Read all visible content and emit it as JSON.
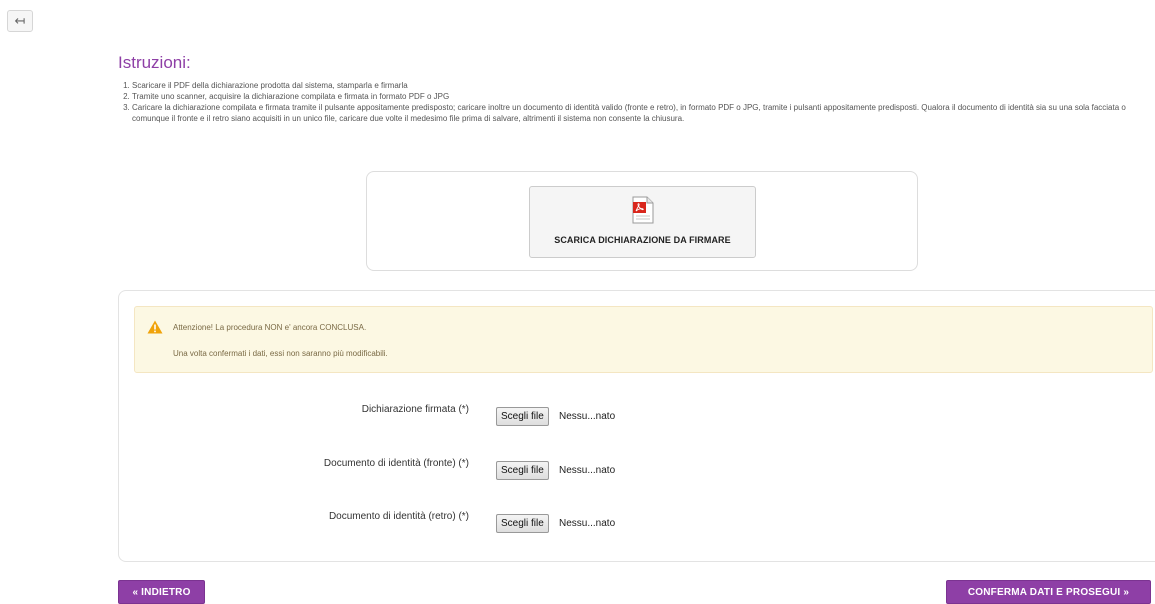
{
  "header": {
    "back_icon": "↤"
  },
  "instructions": {
    "title": "Istruzioni:",
    "items": [
      "Scaricare il PDF della dichiarazione prodotta dal sistema, stamparla e firmarla",
      "Tramite uno scanner, acquisire la dichiarazione compilata e firmata in formato PDF o JPG",
      "Caricare la dichiarazione compilata e firmata tramite il pulsante appositamente predisposto; caricare inoltre un documento di identità valido (fronte e retro), in formato PDF o JPG, tramite i pulsanti appositamente predisposti. Qualora il documento di identità sia su una sola facciata o comunque il fronte e il retro siano acquisiti in un unico file, caricare due volte il medesimo file prima di salvare, altrimenti il sistema non consente la chiusura."
    ]
  },
  "download": {
    "icon": "pdf-icon",
    "label": "SCARICA DICHIARAZIONE DA FIRMARE"
  },
  "alert": {
    "icon": "warning-icon",
    "line1": "Attenzione! La procedura NON e' ancora CONCLUSA.",
    "line2": "Una volta confermati i dati, essi non saranno più modificabili."
  },
  "fields": [
    {
      "label": "Dichiarazione firmata (*)",
      "button": "Scegli file",
      "file": "Nessu...nato"
    },
    {
      "label": "Documento di identità (fronte) (*)",
      "button": "Scegli file",
      "file": "Nessu...nato"
    },
    {
      "label": "Documento di identità (retro) (*)",
      "button": "Scegli file",
      "file": "Nessu...nato"
    }
  ],
  "nav": {
    "back_label": "« INDIETRO",
    "next_label": "CONFERMA DATI E PROSEGUI »"
  },
  "colors": {
    "accent": "#8e3fa6",
    "alert_bg": "#fcf8e3",
    "warning": "#f0a30a",
    "pdf_red": "#d9261c"
  }
}
